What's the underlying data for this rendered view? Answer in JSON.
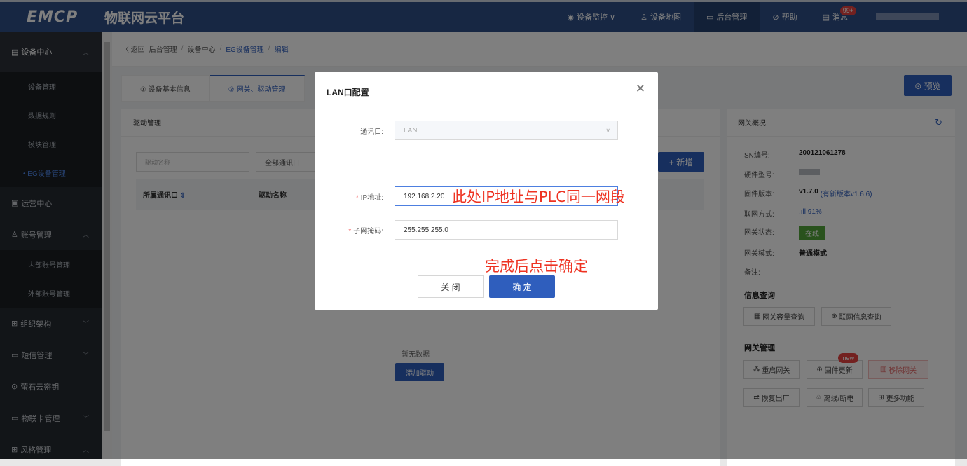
{
  "header": {
    "logo": "EMCP",
    "platform": "物联网云平台",
    "nav": [
      {
        "icon": "location-icon",
        "glyph": "◉",
        "label": "设备监控 ∨"
      },
      {
        "icon": "map-icon",
        "glyph": "♙",
        "label": "设备地图"
      },
      {
        "icon": "monitor-icon",
        "glyph": "▭",
        "label": "后台管理"
      },
      {
        "icon": "help-icon",
        "glyph": "⊘",
        "label": "帮助"
      },
      {
        "icon": "message-icon",
        "glyph": "▤",
        "label": "消息"
      }
    ],
    "message_badge": "99+"
  },
  "sidebar": {
    "device_center": "设备中心",
    "sub_items": [
      "设备管理",
      "数据规则",
      "模块管理",
      "• EG设备管理"
    ],
    "ops_center": "运营中心",
    "account_mgmt": "账号管理",
    "account_subs": [
      "内部账号管理",
      "外部账号管理"
    ],
    "org": "组织架构",
    "sms": "短信管理",
    "ys_key": "萤石云密钥",
    "iot_card": "物联卡管理",
    "style": "风格管理"
  },
  "breadcrumb": {
    "back": "〈 返回",
    "items": [
      "后台管理",
      "设备中心",
      "EG设备管理",
      "编辑"
    ]
  },
  "tabs": [
    "① 设备基本信息",
    "② 网关、驱动管理"
  ],
  "preview_btn": "⊙ 预览",
  "driver_panel": {
    "title": "驱动管理",
    "search_placeholder": "驱动名称",
    "comm_select": "全部通讯口",
    "add_btn": "+ 新增",
    "col1": "所属通讯口",
    "col2": "驱动名称",
    "empty": "暂无数据",
    "add_driver": "添加驱动"
  },
  "gateway": {
    "title": "网关概况",
    "sn_label": "SN编号:",
    "sn": "200121061278",
    "hw_label": "硬件型号:",
    "fw_label": "固件版本:",
    "fw": "v1.7.0",
    "fw_new": "(有新版本v1.6.6)",
    "net_label": "联网方式:",
    "net": ".ıll 91%",
    "status_label": "网关状态:",
    "status": "在线",
    "mode_label": "网关模式:",
    "mode": "普通模式",
    "remark_label": "备注:",
    "info_query": "信息查询",
    "btn_capacity": "网关容量查询",
    "btn_netinfo": "联网信息查询",
    "gw_mgmt": "网关管理",
    "btn_restart": "重启网关",
    "btn_fw": "固件更新",
    "new_tag": "new",
    "btn_remove": "移除网关",
    "btn_reset": "恢复出厂",
    "btn_offline": "离线/断电",
    "btn_more": "更多功能"
  },
  "dialog": {
    "title": "LAN口配置",
    "comm_label": "通讯口:",
    "comm_value": "LAN",
    "dot": "·",
    "ip_label": "IP地址:",
    "ip_value": "192.168.2.20",
    "mask_label": "子网掩码:",
    "mask_value": "255.255.255.0",
    "btn_close": "关 闭",
    "btn_ok": "确 定"
  },
  "annotations": {
    "ip_note": "此处IP地址与PLC同一网段",
    "confirm_note": "完成后点击确定"
  }
}
